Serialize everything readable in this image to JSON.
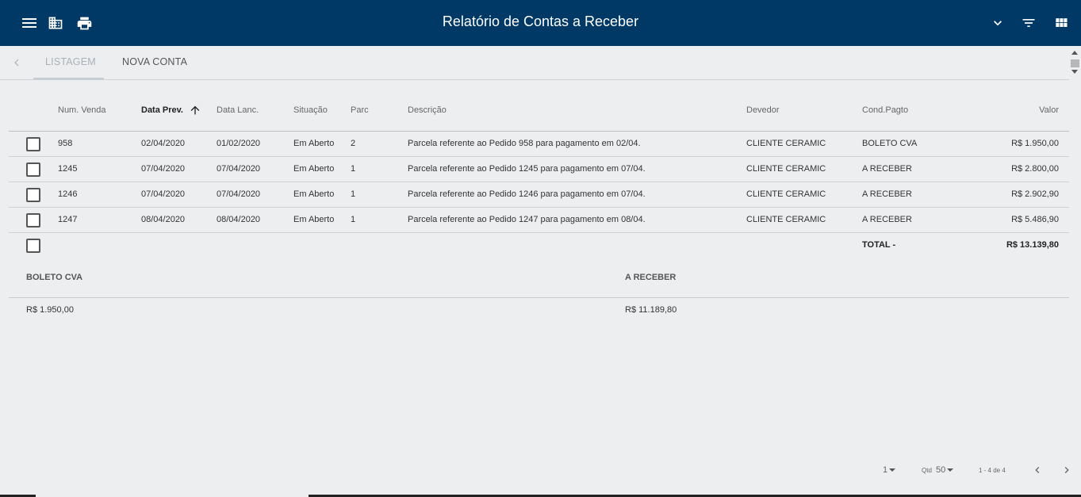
{
  "header": {
    "title": "Relatório de Contas a Receber",
    "icons": [
      "menu-icon",
      "building-icon",
      "print-icon",
      "chevron-down-icon",
      "filter-icon",
      "grid-view-icon"
    ]
  },
  "tabs": {
    "listagem": "LISTAGEM",
    "nova_conta": "NOVA CONTA"
  },
  "table": {
    "headers": {
      "num_venda": "Num. Venda",
      "data_prev": "Data Prev.",
      "data_lanc": "Data Lanc.",
      "situacao": "Situação",
      "parc": "Parc",
      "descricao": "Descrição",
      "devedor": "Devedor",
      "cond_pagto": "Cond.Pagto",
      "valor": "Valor"
    },
    "rows": [
      {
        "num_venda": "958",
        "data_prev": "02/04/2020",
        "data_lanc": "01/02/2020",
        "situacao": "Em Aberto",
        "parc": "2",
        "descricao": "Parcela referente ao Pedido 958 para pagamento em 02/04.",
        "devedor": "CLIENTE CERAMIC",
        "cond_pagto": "BOLETO CVA",
        "valor": "R$ 1.950,00"
      },
      {
        "num_venda": "1245",
        "data_prev": "07/04/2020",
        "data_lanc": "07/04/2020",
        "situacao": "Em Aberto",
        "parc": "1",
        "descricao": "Parcela referente ao Pedido 1245 para pagamento em 07/04.",
        "devedor": "CLIENTE CERAMIC",
        "cond_pagto": "A RECEBER",
        "valor": "R$ 2.800,00"
      },
      {
        "num_venda": "1246",
        "data_prev": "07/04/2020",
        "data_lanc": "07/04/2020",
        "situacao": "Em Aberto",
        "parc": "1",
        "descricao": "Parcela referente ao Pedido 1246 para pagamento em 07/04.",
        "devedor": "CLIENTE CERAMIC",
        "cond_pagto": "A RECEBER",
        "valor": "R$ 2.902,90"
      },
      {
        "num_venda": "1247",
        "data_prev": "08/04/2020",
        "data_lanc": "08/04/2020",
        "situacao": "Em Aberto",
        "parc": "1",
        "descricao": "Parcela referente ao Pedido 1247 para pagamento em 08/04.",
        "devedor": "CLIENTE CERAMIC",
        "cond_pagto": "A RECEBER",
        "valor": "R$ 5.486,90"
      }
    ],
    "total_label": "TOTAL -",
    "total_value": "R$ 13.139,80"
  },
  "summary": {
    "boleto_label": "BOLETO CVA",
    "boleto_value": "R$ 1.950,00",
    "receber_label": "A RECEBER",
    "receber_value": "R$ 11.189,80"
  },
  "pager": {
    "page": "1",
    "qtd_label": "Qtd",
    "qtd_value": "50",
    "range": "1 - 4 de 4"
  }
}
